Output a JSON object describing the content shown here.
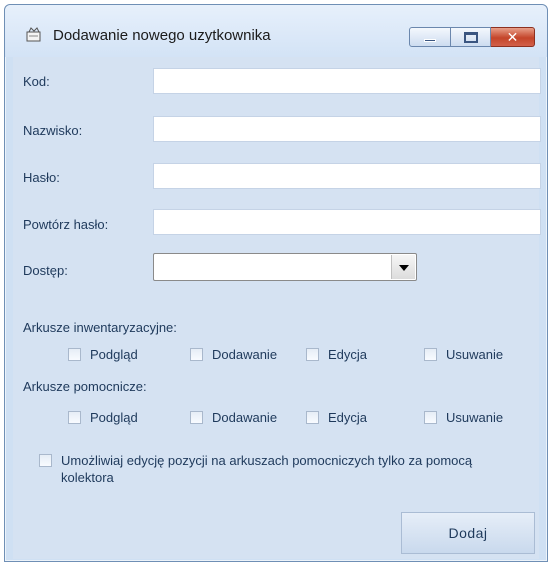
{
  "window": {
    "title": "Dodawanie nowego uzytkownika",
    "close_label": "✕"
  },
  "form": {
    "kod_label": "Kod:",
    "kod_value": "",
    "nazwisko_label": "Nazwisko:",
    "nazwisko_value": "",
    "haslo_label": "Hasło:",
    "haslo_value": "",
    "powtorz_label": "Powtórz hasło:",
    "powtorz_value": "",
    "dostep_label": "Dostęp:",
    "dostep_value": ""
  },
  "arkusze_inwentaryzacyjne": {
    "label": "Arkusze inwentaryzacyjne:",
    "options": [
      "Podgląd",
      "Dodawanie",
      "Edycja",
      "Usuwanie"
    ]
  },
  "arkusze_pomocnicze": {
    "label": "Arkusze pomocnicze:",
    "options": [
      "Podgląd",
      "Dodawanie",
      "Edycja",
      "Usuwanie"
    ]
  },
  "kolektor": {
    "label": "Umożliwiaj edycję pozycji na arkuszach pomocniczych tylko za pomocą kolektora"
  },
  "actions": {
    "add_label": "Dodaj"
  },
  "colors": {
    "titlebar": "#d3e3f6",
    "client": "#d5e2f2",
    "text": "#1e395b",
    "close": "#c4452a"
  }
}
